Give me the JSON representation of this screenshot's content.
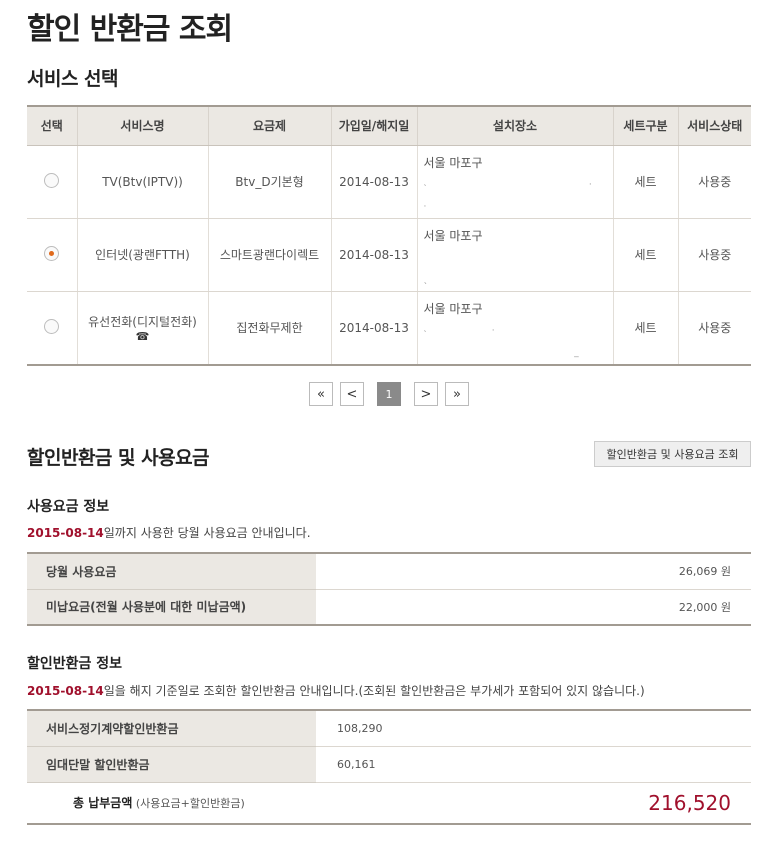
{
  "page_title": "할인 반환금 조회",
  "service_section": {
    "title": "서비스 선택",
    "columns": [
      "선택",
      "서비스명",
      "요금제",
      "가입일/해지일",
      "설치장소",
      "세트구분",
      "서비스상태"
    ],
    "rows": [
      {
        "selected": false,
        "name": "TV(Btv(IPTV))",
        "plan": "Btv_D기본형",
        "date": "2014-08-13",
        "address": "서울 마포구",
        "set_type": "세트",
        "status": "사용중"
      },
      {
        "selected": true,
        "name": "인터넷(광랜FTTH)",
        "plan": "스마트광랜다이렉트",
        "date": "2014-08-13",
        "address": "서울 마포구",
        "set_type": "세트",
        "status": "사용중"
      },
      {
        "selected": false,
        "name": "유선전화(디지털전화)",
        "plan": "집전화무제한",
        "date": "2014-08-13",
        "address": "서울 마포구",
        "set_type": "세트",
        "status": "사용중"
      }
    ]
  },
  "pagination": {
    "first": "«",
    "prev": "<",
    "current": "1",
    "next": ">",
    "last": "»"
  },
  "refund_section": {
    "title": "할인반환금 및 사용요금",
    "query_button": "할인반환금 및 사용요금 조회"
  },
  "usage_info": {
    "title": "사용요금 정보",
    "notice_date": "2015-08-14",
    "notice_text": "일까지 사용한 당월 사용요금 안내입니다.",
    "rows": [
      {
        "label": "당월 사용요금",
        "value": "26,069 원"
      },
      {
        "label": "미납요금(전월 사용분에 대한 미납금액)",
        "value": "22,000 원"
      }
    ]
  },
  "refund_info": {
    "title": "할인반환금 정보",
    "notice_date": "2015-08-14",
    "notice_text": "일을 해지 기준일로 조회한 할인반환금 안내입니다.(조회된 할인반환금은 부가세가 포함되어 있지 않습니다.)",
    "rows": [
      {
        "label": "서비스정기계약할인반환금",
        "value": "108,290"
      },
      {
        "label": "임대단말 할인반환금",
        "value": "60,161"
      }
    ],
    "total_label": "총 납부금액",
    "total_note": "(사용요금+할인반환금)",
    "total_amount": "216,520"
  }
}
